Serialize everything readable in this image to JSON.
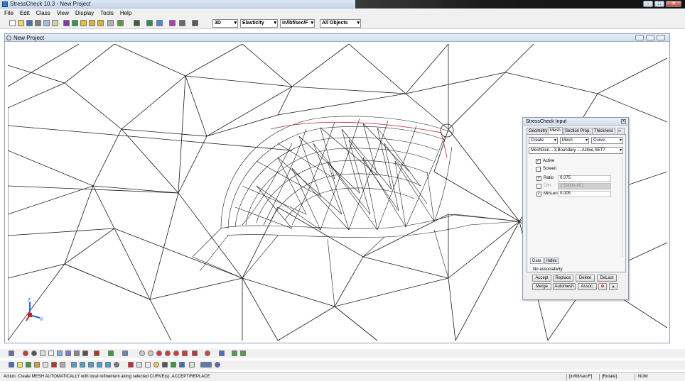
{
  "window": {
    "title": "StressCheck 10.3 - New Project"
  },
  "menu": [
    "File",
    "Edit",
    "Class",
    "View",
    "Display",
    "Tools",
    "Help"
  ],
  "toolbar": {
    "view_mode": "3D",
    "analysis": "Elasticity",
    "units": "in/lbf/sec/F",
    "objects": "All Objects"
  },
  "mdi": {
    "title": "New Project"
  },
  "panel": {
    "title": "StressCheck Input",
    "tabs": [
      "Geometry",
      "Mesh",
      "Section Prop.",
      "Thickness"
    ],
    "active_tab": "Mesh",
    "action": "Create",
    "class": "Mesh",
    "method": "Curve",
    "record": "MeshGen... 3,Boundary ...,Active,SET7",
    "active_label": "Active",
    "active_checked": true,
    "screen_label": "Screen",
    "screen_checked": false,
    "params": [
      {
        "label": "Ratio",
        "value": "0.075",
        "checked": true,
        "enabled": true
      },
      {
        "label": "D/H",
        "value": "1.5000e-001",
        "checked": false,
        "enabled": false
      },
      {
        "label": "MinLen",
        "value": "0.005",
        "checked": true,
        "enabled": true
      }
    ],
    "subtabs": [
      "Data",
      "Index"
    ],
    "assoc_text": "No associativity",
    "buttons_row1": [
      "Accept",
      "Replace",
      "Delete",
      "DeLast"
    ],
    "buttons_row2": [
      "Merge",
      "Automesh",
      "Assoc."
    ]
  },
  "triad": {
    "z": "Z",
    "x": "X"
  },
  "status": {
    "action": "Action:  Create MESH AUTOMATICALLY with local refinement along selected CURVE(s), ACCEPT/REPLACE",
    "units": "[in/lbf/sec/F]",
    "mode": "[Rotate]",
    "num": "NUM"
  },
  "colors": {
    "accent_curve": "#c04040",
    "mesh_line": "#1a1a1a"
  }
}
